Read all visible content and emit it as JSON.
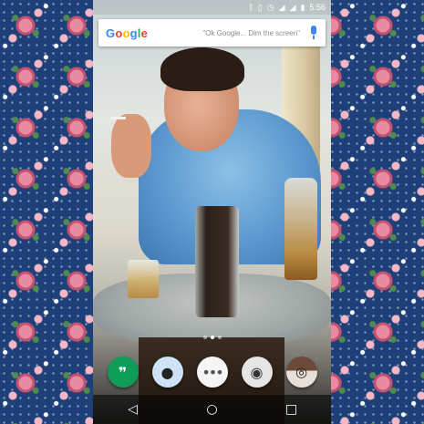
{
  "status_bar": {
    "time": "5:56",
    "icons": [
      "bluetooth-icon",
      "vibrate-icon",
      "alarm-icon",
      "wifi-icon",
      "signal-icon",
      "battery-icon"
    ]
  },
  "search": {
    "logo": "Google",
    "hint": "\"Ok Google... Dim the screen\""
  },
  "home": {
    "page_count": 3,
    "active_page": 2
  },
  "dock": {
    "apps": [
      "hangouts",
      "reddit",
      "app-drawer",
      "alien-app",
      "camera"
    ],
    "icon_glyphs": [
      "❞",
      "●",
      "•••",
      "◉",
      "◎"
    ]
  },
  "nav": {
    "back_glyph": "◁",
    "home_glyph": "○",
    "recents_glyph": "□"
  },
  "colors": {
    "wallpaper_bg": "#1f3f78",
    "google_blue": "#4285f4",
    "google_red": "#ea4335",
    "google_yellow": "#fbbc05",
    "google_green": "#34a853"
  }
}
